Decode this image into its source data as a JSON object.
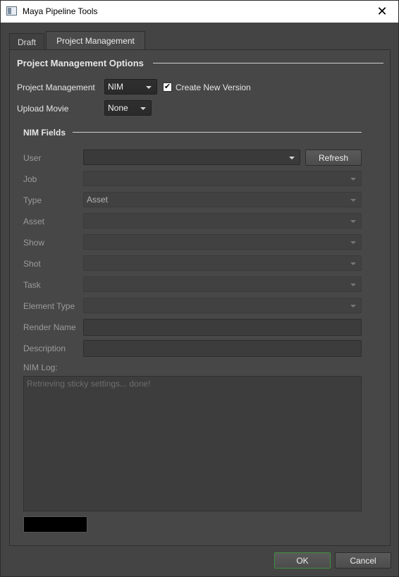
{
  "window": {
    "title": "Maya Pipeline Tools",
    "close_glyph": "✕"
  },
  "tabs": [
    {
      "label": "Draft",
      "selected": false
    },
    {
      "label": "Project Management",
      "selected": true
    }
  ],
  "options": {
    "section_title": "Project Management Options",
    "project_management": {
      "label": "Project Management",
      "value": "NIM"
    },
    "create_new_version": {
      "label": "Create New Version",
      "checked": true
    },
    "upload_movie": {
      "label": "Upload Movie",
      "value": "None"
    }
  },
  "nim": {
    "section_title": "NIM Fields",
    "fields": [
      {
        "label": "User",
        "value": ""
      },
      {
        "label": "Job",
        "value": ""
      },
      {
        "label": "Type",
        "value": "Asset"
      },
      {
        "label": "Asset",
        "value": ""
      },
      {
        "label": "Show",
        "value": ""
      },
      {
        "label": "Shot",
        "value": ""
      },
      {
        "label": "Task",
        "value": ""
      },
      {
        "label": "Element Type",
        "value": ""
      },
      {
        "label": "Render Name",
        "value": ""
      },
      {
        "label": "Description",
        "value": ""
      }
    ],
    "refresh_label": "Refresh",
    "log_label": "NIM Log:",
    "log_text": "Retrieving sticky settings... done!"
  },
  "footer": {
    "ok_label": "OK",
    "cancel_label": "Cancel"
  },
  "colors": {
    "ok_border": "#3e8f3e",
    "background": "#444444"
  }
}
